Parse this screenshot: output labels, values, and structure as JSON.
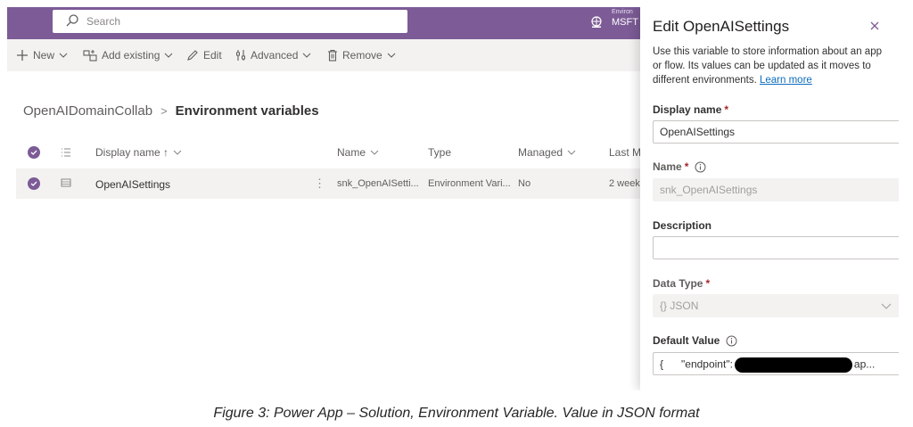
{
  "header": {
    "search_placeholder": "Search",
    "environment_label": "Environ",
    "environment_name": "MSFT"
  },
  "command_bar": {
    "new": "New",
    "add_existing": "Add existing",
    "edit": "Edit",
    "advanced": "Advanced",
    "remove": "Remove"
  },
  "breadcrumb": {
    "parent": "OpenAIDomainCollab",
    "current": "Environment variables"
  },
  "table": {
    "columns": [
      "Display name",
      "Name",
      "Type",
      "Managed",
      "Last M"
    ],
    "sort_indicator": "↑",
    "rows": [
      {
        "display_name": "OpenAISettings",
        "more": "⋮",
        "name": "snk_OpenAISetti...",
        "type": "Environment Vari...",
        "managed": "No",
        "last_modified": "2 weeks"
      }
    ]
  },
  "panel": {
    "title": "Edit OpenAISettings",
    "description": "Use this variable to store information about an app or flow. Its values can be updated as it moves to different environments.",
    "learn_more": "Learn more",
    "display_name_label": "Display name",
    "display_name_value": "OpenAISettings",
    "name_label": "Name",
    "name_value": "snk_OpenAISettings",
    "description_label": "Description",
    "description_value": "",
    "data_type_label": "Data Type",
    "data_type_value": "{} JSON",
    "default_value_label": "Default Value",
    "default_value_start": "{      \"endpoint\":",
    "default_value_end": "ap...",
    "required_mark": "*"
  },
  "caption": "Figure 3: Power App – Solution, Environment Variable. Value in JSON format",
  "colors": {
    "header": "#7c5b96",
    "accent": "#7c5b96",
    "link": "#0f6cbd",
    "required": "#a4262c"
  },
  "icons": [
    "search-icon",
    "environment-icon",
    "add-icon",
    "add-existing-icon",
    "edit-icon",
    "advanced-icon",
    "remove-icon",
    "check-circle-icon",
    "list-icon",
    "row-icon",
    "close-icon",
    "info-icon",
    "chevron-down-icon"
  ]
}
